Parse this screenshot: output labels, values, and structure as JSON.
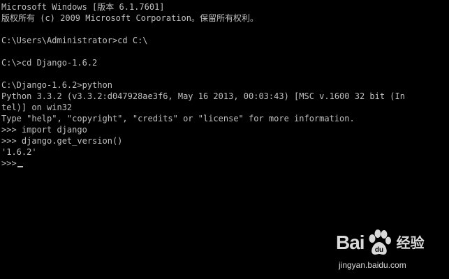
{
  "console": {
    "lines": [
      "Microsoft Windows [版本 6.1.7601]",
      "版权所有 (c) 2009 Microsoft Corporation。保留所有权利。",
      "",
      "C:\\Users\\Administrator>cd C:\\",
      "",
      "C:\\>cd Django-1.6.2",
      "",
      "C:\\Django-1.6.2>python",
      "Python 3.3.2 (v3.3.2:d047928ae3f6, May 16 2013, 00:03:43) [MSC v.1600 32 bit (In",
      "tel)] on win32",
      "Type \"help\", \"copyright\", \"credits\" or \"license\" for more information.",
      ">>> import django",
      ">>> django.get_version()",
      "'1.6.2'",
      ">>>"
    ]
  },
  "watermark": {
    "brand_left": "Bai",
    "brand_right": "经验",
    "url": "jingyan.baidu.com",
    "icon": "baidu-paw-icon"
  },
  "colors": {
    "background": "#000000",
    "text": "#c0c0c0"
  }
}
